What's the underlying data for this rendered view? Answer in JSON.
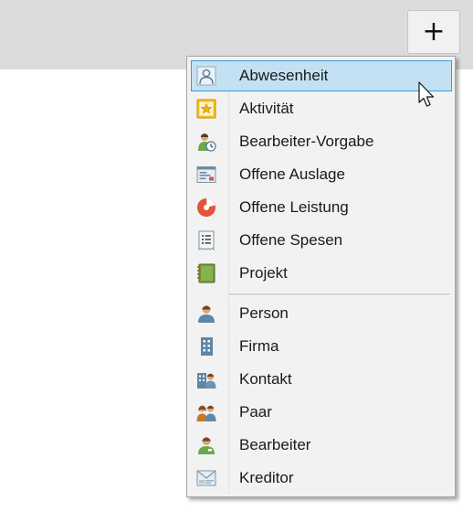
{
  "toolbar": {
    "add_button_label": "+"
  },
  "menu": {
    "items": [
      {
        "label": "Abwesenheit",
        "icon": "absence-person-icon",
        "highlighted": true
      },
      {
        "label": "Aktivität",
        "icon": "star-activity-icon"
      },
      {
        "label": "Bearbeiter-Vorgabe",
        "icon": "user-clock-icon"
      },
      {
        "label": "Offene Auslage",
        "icon": "receipt-card-icon"
      },
      {
        "label": "Offene Leistung",
        "icon": "pie-chart-icon"
      },
      {
        "label": "Offene Spesen",
        "icon": "expense-list-icon"
      },
      {
        "label": "Projekt",
        "icon": "project-binder-icon"
      },
      {
        "label": "Person",
        "icon": "person-icon"
      },
      {
        "label": "Firma",
        "icon": "building-icon"
      },
      {
        "label": "Kontakt",
        "icon": "contact-building-person-icon"
      },
      {
        "label": "Paar",
        "icon": "couple-icon"
      },
      {
        "label": "Bearbeiter",
        "icon": "employee-icon"
      },
      {
        "label": "Kreditor",
        "icon": "creditor-envelope-icon"
      }
    ]
  },
  "colors": {
    "highlight_bg": "#c4e1f4",
    "highlight_border": "#3a9ad9",
    "menu_bg": "#f2f2f2",
    "topbar_bg": "#dcdcdc"
  }
}
